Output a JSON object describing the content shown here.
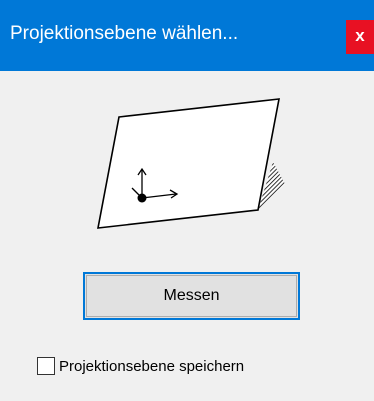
{
  "window": {
    "title": "Projektionsebene wählen...",
    "close_label": "x"
  },
  "illustration": {
    "icon": "projection-plane-icon"
  },
  "buttons": {
    "measure_label": "Messen"
  },
  "options": {
    "save_plane_label": "Projektionsebene speichern",
    "save_plane_checked": false
  },
  "colors": {
    "titlebar": "#0078d7",
    "close": "#e81123",
    "background": "#f0f0f0"
  }
}
